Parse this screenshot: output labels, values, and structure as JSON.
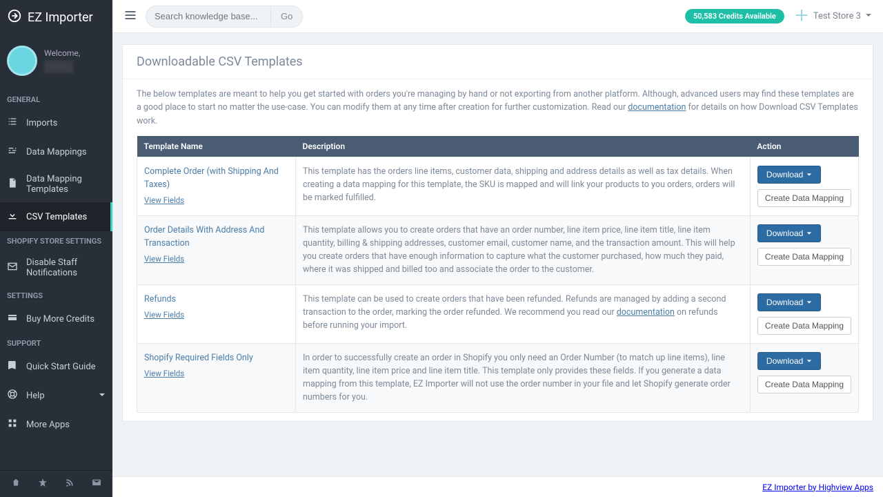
{
  "brand": {
    "title": "EZ Importer"
  },
  "user": {
    "welcome": "Welcome,"
  },
  "sidebar": {
    "sections": [
      {
        "label": "GENERAL",
        "items": [
          {
            "label": "Imports",
            "icon": "list-icon",
            "active": false
          },
          {
            "label": "Data Mappings",
            "icon": "sliders-icon",
            "active": false
          },
          {
            "label": "Data Mapping Templates",
            "icon": "document-icon",
            "active": false
          },
          {
            "label": "CSV Templates",
            "icon": "download-icon",
            "active": true
          }
        ]
      },
      {
        "label": "SHOPIFY STORE SETTINGS",
        "items": [
          {
            "label": "Disable Staff Notifications",
            "icon": "envelope-icon",
            "active": false
          }
        ]
      },
      {
        "label": "SETTINGS",
        "items": [
          {
            "label": "Buy More Credits",
            "icon": "card-icon",
            "active": false
          }
        ]
      },
      {
        "label": "SUPPORT",
        "items": [
          {
            "label": "Quick Start Guide",
            "icon": "book-icon",
            "active": false
          },
          {
            "label": "Help",
            "icon": "life-ring-icon",
            "active": false,
            "caret": true
          },
          {
            "label": "More Apps",
            "icon": "grid-icon",
            "active": false
          }
        ]
      }
    ]
  },
  "topbar": {
    "search_placeholder": "Search knowledge base...",
    "go_label": "Go",
    "credits": "50,583 Credits Available",
    "store": "Test Store 3"
  },
  "page": {
    "title": "Downloadable CSV Templates",
    "intro_before": "The below templates are meant to help you get started with orders you're managing by hand or not exporting from another platform. Although, advanced users may find these templates are a good place to start no matter the use-case. You can modify them at any time after creation for further customization. Read our ",
    "intro_link": "documentation",
    "intro_after": " for details on how Download CSV Templates work.",
    "columns": {
      "name": "Template Name",
      "desc": "Description",
      "action": "Action"
    },
    "view_fields_label": "View Fields",
    "download_label": "Download",
    "create_mapping_label": "Create Data Mapping",
    "templates": [
      {
        "name": "Complete Order (with Shipping And Taxes)",
        "desc": "This template has the orders line items, customer data, shipping and address details as well as tax details. When creating a data mapping for this template, the SKU is mapped and will link your products to you orders, orders will be marked fulfilled."
      },
      {
        "name": "Order Details With Address And Transaction",
        "desc": "This template allows you to create orders that have an order number, line item price, line item title, line item quantity, billing & shipping addresses, customer email, customer name, and the transaction amount. This will help you create orders that have enough information to capture what the customer purchased, how much they paid, where it was shipped and billed too and associate the order to the customer."
      },
      {
        "name": "Refunds",
        "desc_before": "This template can be used to create orders that have been refunded. Refunds are managed by adding a second transaction to the order, marking the order refunded. We recommend you read our ",
        "desc_link": "documentation",
        "desc_after": " on refunds before running your import."
      },
      {
        "name": "Shopify Required Fields Only",
        "desc": "In order to successfully create an order in Shopify you only need an Order Number (to match up line items), line item quantity, line item price and line item title. This template only provides these fields. If you generate a data mapping from this template, EZ Importer will not use the order number in your file and let Shopify generate order numbers for you."
      }
    ]
  },
  "footer": {
    "text": "EZ Importer by Highview Apps"
  }
}
